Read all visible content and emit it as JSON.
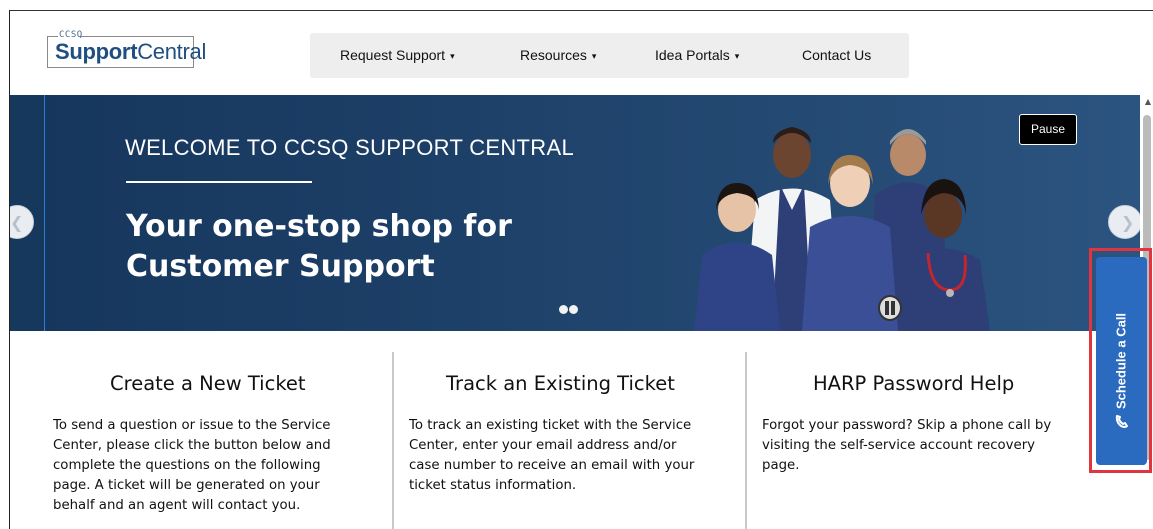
{
  "header": {
    "logo_small": "CCSQ",
    "logo_main_bold": "Support",
    "logo_main_rest": "Central",
    "nav": [
      {
        "label": "Request Support",
        "has_dropdown": true
      },
      {
        "label": "Resources",
        "has_dropdown": true
      },
      {
        "label": "Idea Portals",
        "has_dropdown": true
      },
      {
        "label": "Contact Us",
        "has_dropdown": false
      }
    ],
    "caret": "▾"
  },
  "hero": {
    "welcome": "WELCOME TO CCSQ SUPPORT CENTRAL",
    "tagline_line1": "Your one-stop shop for",
    "tagline_line2": "Customer Support",
    "pause_label": "Pause",
    "prev_icon": "chevron-left-icon",
    "next_icon": "chevron-right-icon",
    "background_color": "#1c3d63"
  },
  "schedule": {
    "label": "Schedule a Call",
    "icon": "phone-icon",
    "color": "#2a6bbf",
    "highlight_color": "#e0343f"
  },
  "columns": [
    {
      "title": "Create a New Ticket",
      "lines": [
        "To send a question or issue to the Service",
        "Center, please click the button below and",
        "complete the questions on the following",
        "page. A ticket will be generated on your",
        "behalf and an agent will contact you."
      ]
    },
    {
      "title": "Track an Existing Ticket",
      "lines": [
        "To track an existing ticket with the Service",
        "Center, enter your email address and/or",
        "case number to receive an email with your",
        "ticket status information."
      ]
    },
    {
      "title": "HARP Password Help",
      "lines": [
        "Forgot your password? Skip a phone call by",
        "visiting the self-service account recovery",
        "page."
      ]
    }
  ]
}
